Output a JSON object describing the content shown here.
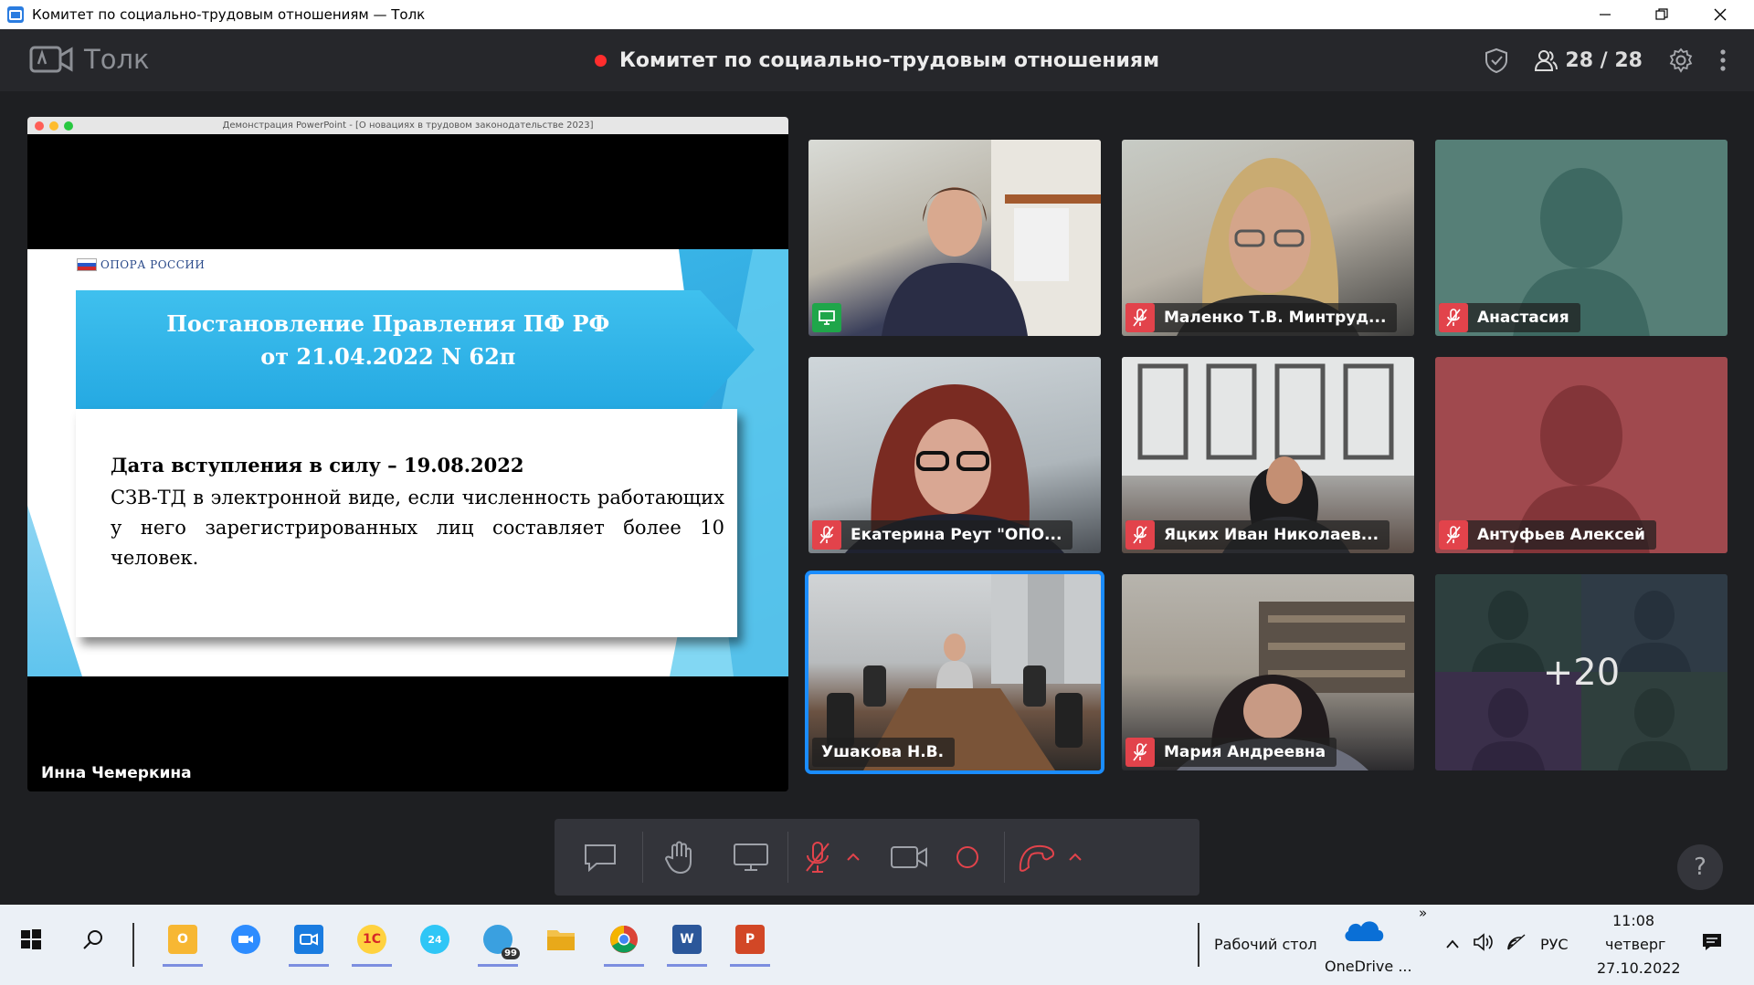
{
  "window": {
    "title": "Комитет по социально-трудовым отношениям — Толк"
  },
  "app": {
    "brand": "Толк",
    "meeting_title": "Комитет по социально-трудовым отношениям",
    "participants": "28 / 28",
    "rec_color": "#ff2d2d"
  },
  "share": {
    "doc_title": "Демонстрация PowerPoint - [О новациях в трудовом законодательстве 2023]",
    "logo_text": "ОПОРА РОССИИ",
    "banner_line1": "Постановление Правления ПФ РФ",
    "banner_line2": "от 21.04.2022 N 62п",
    "heading": "Дата вступления в силу – 19.08.2022",
    "body": "СЗВ-ТД в электронной виде, если численность работающих у него зарегистрированных лиц составляет более 10 человек.",
    "presenter": "Инна Чемеркина"
  },
  "tiles": [
    {
      "name": "",
      "icon": "screen-share-icon"
    },
    {
      "name": "Маленко Т.В. Минтруд...",
      "icon": "mic-off-icon"
    },
    {
      "name": "Анастасия",
      "icon": "mic-off-icon"
    },
    {
      "name": "Екатерина Реут \"ОПО...",
      "icon": "mic-off-icon"
    },
    {
      "name": "Яцких Иван Николаев...",
      "icon": "mic-off-icon"
    },
    {
      "name": "Антуфьев Алексей",
      "icon": "mic-off-icon"
    },
    {
      "name": "Ушакова Н.В.",
      "icon": ""
    },
    {
      "name": "Мария Андреевна",
      "icon": "mic-off-icon"
    },
    {
      "name": "+20",
      "icon": ""
    }
  ],
  "toolbar": {
    "items": [
      "chat-icon",
      "raise-hand-icon",
      "screen-share-icon",
      "mic-off-icon",
      "chevron-up-icon",
      "camera-icon",
      "record-icon",
      "hangup-icon",
      "chevron-up-icon"
    ],
    "help": "?"
  },
  "taskbar": {
    "desktop_label": "Рабочий стол",
    "onedrive_label": "OneDrive ...",
    "lang": "РУС",
    "time": "11:08",
    "weekday": "четверг",
    "date": "27.10.2022",
    "badge": "99",
    "overflow": "»"
  }
}
